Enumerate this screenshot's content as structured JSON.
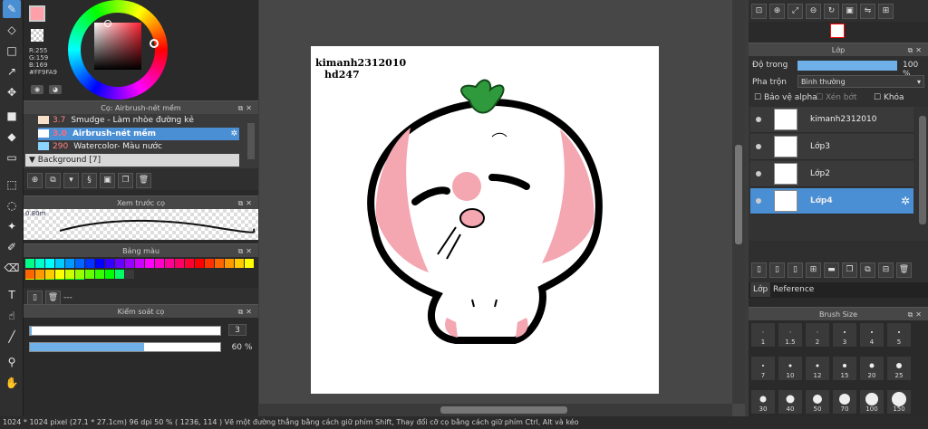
{
  "color": {
    "r": "R:255",
    "g": "G:159",
    "b": "B:169",
    "hex": "#FF9FA9",
    "main_hex": "#ff9fa9"
  },
  "brush_panel": {
    "title": "Cọ: Airbrush-nét mềm",
    "items": [
      {
        "size": "3.7",
        "name": "Smudge - Làm nhòe đường kẻ",
        "swatch": "#f6e0c8"
      },
      {
        "size": "3.0",
        "name": "Airbrush-nét mềm",
        "swatch": "#ffffff"
      },
      {
        "size": "290",
        "name": "Watercolor- Màu nước",
        "swatch": "#8ad4ff"
      }
    ],
    "group": "Background [7]"
  },
  "preview_panel": {
    "title": "Xem trước cọ",
    "size_label": "0.80m"
  },
  "palette_panel": {
    "title": "Bảng màu",
    "dash": "---"
  },
  "control_panel": {
    "title": "Kiểm soát cọ",
    "size_value": "3",
    "opacity_value": "60 %",
    "size_fraction": 0.01,
    "opacity_fraction": 0.6
  },
  "canvas": {
    "line1": "kimanh2312010",
    "line2": "hd247"
  },
  "layer_panel": {
    "title": "Lớp",
    "opacity_label": "Độ trong",
    "opacity_value": "100 %",
    "opacity_fraction": 1.0,
    "blend_label": "Pha trộn",
    "blend_value": "Bình thường",
    "checks": [
      "Bảo vệ alpha",
      "Xén bớt",
      "Khóa"
    ],
    "layers": [
      {
        "name": "kimanh2312010",
        "selected": false
      },
      {
        "name": "Lớp3",
        "selected": false
      },
      {
        "name": "Lớp2",
        "selected": false
      },
      {
        "name": "Lớp4",
        "selected": true
      }
    ],
    "tabs": [
      "Lớp",
      "Reference"
    ]
  },
  "brush_size_panel": {
    "title": "Brush Size",
    "sizes": [
      "1",
      "1.5",
      "2",
      "3",
      "4",
      "5",
      "7",
      "10",
      "12",
      "15",
      "20",
      "25",
      "30",
      "40",
      "50",
      "70",
      "100",
      "150"
    ]
  },
  "status": {
    "text": "1024 * 1024 pixel   (27.1 * 27.1cm)   96 dpi   50 %   ( 1236, 114 )   Vẽ một đường thẳng bằng cách giữ phím Shift, Thay đổi cỡ cọ bằng cách giữ phím Ctrl, Alt và kéo"
  }
}
